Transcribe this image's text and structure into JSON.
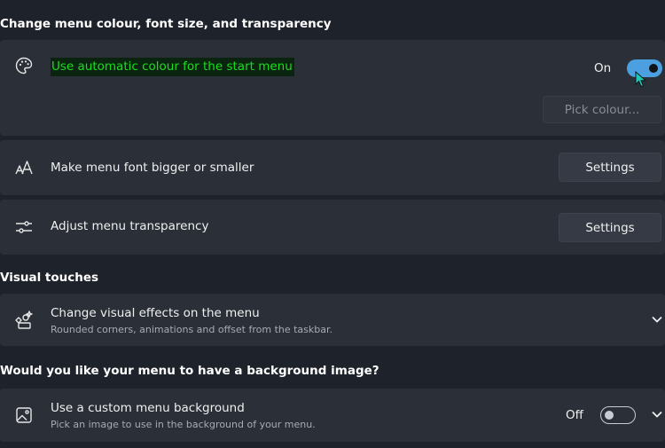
{
  "sections": {
    "colour_title": "Change menu colour, font size, and transparency",
    "visual_title": "Visual touches",
    "background_title": "Would you like your menu to have a background image?"
  },
  "auto_colour": {
    "label": "Use automatic colour for the start menu",
    "toggle_text": "On",
    "toggle_state": true,
    "pick_button": "Pick colour...",
    "icon": "palette-icon"
  },
  "font_size": {
    "label": "Make menu font bigger or smaller",
    "button": "Settings",
    "icon": "font-size-icon"
  },
  "transparency": {
    "label": "Adjust menu transparency",
    "button": "Settings",
    "icon": "sliders-icon"
  },
  "visual_effects": {
    "label": "Change visual effects on the menu",
    "sublabel": "Rounded corners, animations and offset from the taskbar.",
    "icon": "sparkle-shapes-icon"
  },
  "custom_background": {
    "label": "Use a custom menu background",
    "sublabel": "Pick an image to use in the background of your menu.",
    "toggle_text": "Off",
    "toggle_state": false,
    "icon": "image-icon"
  },
  "colors": {
    "accent": "#4ca0e0",
    "highlight_text": "#16e01c",
    "background": "#1e222a",
    "card": "#2a2f38"
  }
}
